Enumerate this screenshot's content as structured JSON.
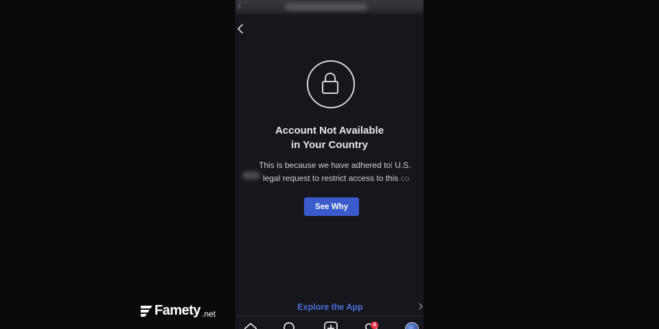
{
  "header": {
    "back_icon": "chevron-left-icon"
  },
  "notice": {
    "icon": "lock-icon",
    "title_line1": "Account Not Available",
    "title_line2": "in Your Country",
    "body_line1": "This is because we have adhered to",
    "body_line1_tail": "U.S.",
    "body_line2": "legal request to restrict access to this",
    "body_line2_tail": "co",
    "button_label": "See Why"
  },
  "footer": {
    "explore_label": "Explore the App",
    "explore_icon": "chevron-right-icon"
  },
  "tabbar": {
    "items": [
      {
        "name": "home",
        "icon": "home-icon"
      },
      {
        "name": "search",
        "icon": "search-icon"
      },
      {
        "name": "create",
        "icon": "plus-square-icon"
      },
      {
        "name": "activity",
        "icon": "heart-icon"
      },
      {
        "name": "profile",
        "icon": "avatar"
      }
    ],
    "activity_badge": "4"
  },
  "watermark": {
    "brand": "Famety",
    "tld": ".net",
    "icon": "famety-logo-icon"
  },
  "colors": {
    "background": "#0a0a0a",
    "screen": "#16171c",
    "accent": "#3b5bcd",
    "link": "#4a6fd6",
    "badge": "#e33a4a"
  }
}
